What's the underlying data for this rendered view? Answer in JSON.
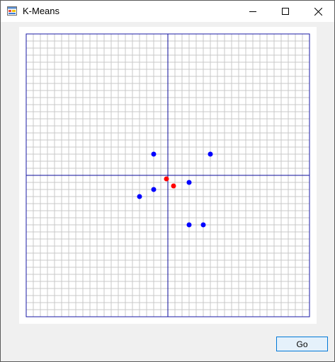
{
  "window": {
    "title": "K-Means"
  },
  "buttons": {
    "go_label": "Go"
  },
  "colors": {
    "grid_line": "#c8c8c8",
    "axis": "#0a0a9a",
    "border": "#1a1aa6",
    "data_point": "#0000ff",
    "centroid": "#ff0000"
  },
  "chart_data": {
    "type": "scatter",
    "xlim": [
      -20,
      20
    ],
    "ylim": [
      -20,
      20
    ],
    "grid": true,
    "series": [
      {
        "role": "points",
        "points": [
          {
            "x": -2,
            "y": 3
          },
          {
            "x": 6,
            "y": 3
          },
          {
            "x": 3,
            "y": -1
          },
          {
            "x": -2,
            "y": -2
          },
          {
            "x": -4,
            "y": -3
          },
          {
            "x": 3,
            "y": -7
          },
          {
            "x": 5,
            "y": -7
          }
        ]
      },
      {
        "role": "centroids",
        "points": [
          {
            "x": -0.2,
            "y": -0.5
          },
          {
            "x": 0.8,
            "y": -1.5
          }
        ]
      }
    ]
  }
}
